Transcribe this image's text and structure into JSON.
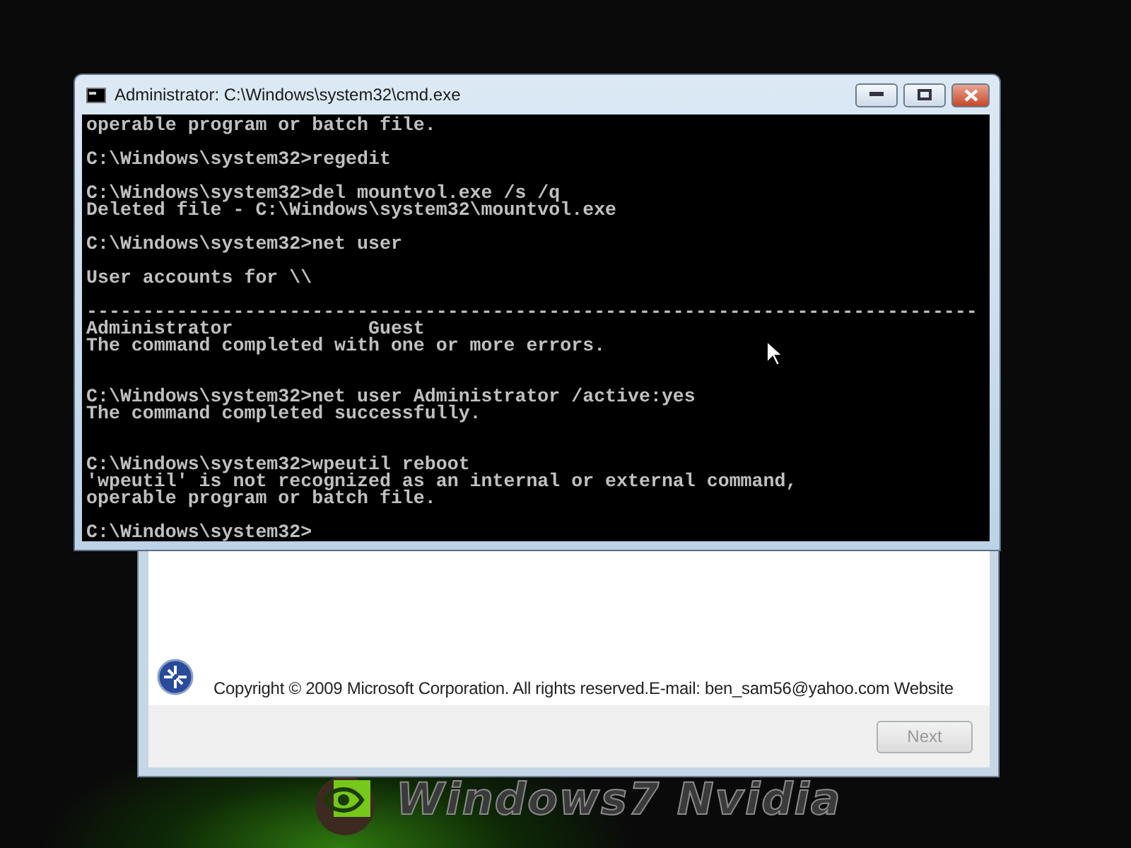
{
  "wallpaper": {
    "caption": "Windows7 Nvidia"
  },
  "setup_dialog": {
    "copyright": "Copyright © 2009 Microsoft Corporation.  All rights reserved.E-mail: ben_sam56@yahoo.com Website",
    "next_button": {
      "label": "Next",
      "disabled": true
    }
  },
  "console_window": {
    "title": "Administrator: C:\\Windows\\system32\\cmd.exe",
    "blocks": [
      {
        "lines": [
          "operable program or batch file."
        ],
        "double_gap": false
      },
      {
        "lines": [
          "C:\\Windows\\system32>regedit"
        ],
        "double_gap": false
      },
      {
        "lines": [
          "C:\\Windows\\system32>del mountvol.exe /s /q",
          "Deleted file - C:\\Windows\\system32\\mountvol.exe"
        ],
        "double_gap": false
      },
      {
        "lines": [
          "C:\\Windows\\system32>net user"
        ],
        "double_gap": false
      },
      {
        "lines": [
          "User accounts for \\\\"
        ],
        "double_gap": false
      },
      {
        "lines": [
          "-------------------------------------------------------------------------------",
          "Administrator            Guest",
          "The command completed with one or more errors."
        ],
        "double_gap": true
      },
      {
        "lines": [
          "C:\\Windows\\system32>net user Administrator /active:yes",
          "The command completed successfully."
        ],
        "double_gap": true
      },
      {
        "lines": [
          "C:\\Windows\\system32>wpeutil reboot",
          "'wpeutil' is not recognized as an internal or external command,",
          "operable program or batch file."
        ],
        "double_gap": false
      },
      {
        "lines": [
          "C:\\Windows\\system32>"
        ],
        "double_gap": false
      }
    ]
  }
}
